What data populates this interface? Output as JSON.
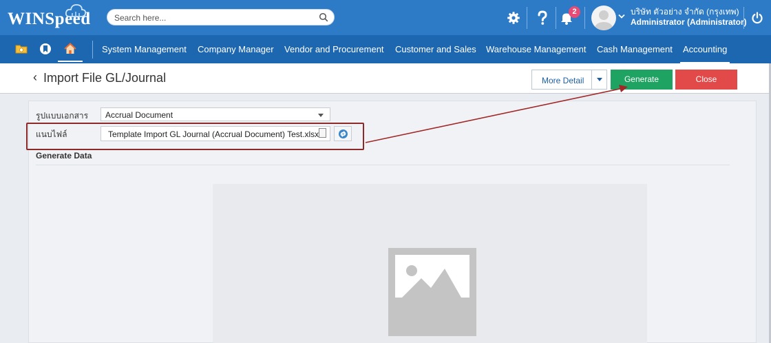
{
  "app": {
    "brand": "WINSpeed",
    "search_placeholder": "Search here...",
    "notification_count": "2",
    "user_company": "บริษัท ตัวอย่าง จำกัด (กรุงเทพ)",
    "user_role": "Administrator (Administrator)"
  },
  "icons": {
    "logo": "cloud-icon",
    "search": "search-icon",
    "settings": "gear-icon",
    "help": "question-icon",
    "notifications": "bell-icon",
    "account": "avatar-icon",
    "dropdown": "chevron-down-icon",
    "power": "power-icon",
    "menu_folder": "folder-icon",
    "menu_bookmark": "bookmark-icon",
    "menu_home": "home-icon"
  },
  "menu": {
    "items": [
      {
        "label": "System Management"
      },
      {
        "label": "Company Manager"
      },
      {
        "label": "Vendor and Procurement"
      },
      {
        "label": "Customer and Sales"
      },
      {
        "label": "Warehouse Management"
      },
      {
        "label": "Cash Management"
      },
      {
        "label": "Accounting",
        "active": true
      }
    ]
  },
  "page": {
    "back_symbol": "‹",
    "title": "Import File GL/Journal",
    "more_detail_label": "More Detail",
    "generate_label": "Generate",
    "close_label": "Close"
  },
  "form": {
    "doc_type_label": "รูปแบบเอกสาร",
    "doc_type_value": "Accrual Document",
    "attach_label": "แนบไฟล์",
    "attach_value": "Template Import GL Journal (Accrual Document) Test.xlsx",
    "section_title": "Generate Data"
  },
  "colors": {
    "topbar": "#2d7bc6",
    "menubar": "#1d67b1",
    "generate": "#1fa362",
    "close": "#e24a4a",
    "highlight": "#8c2a2a",
    "badge": "#e94b77"
  }
}
